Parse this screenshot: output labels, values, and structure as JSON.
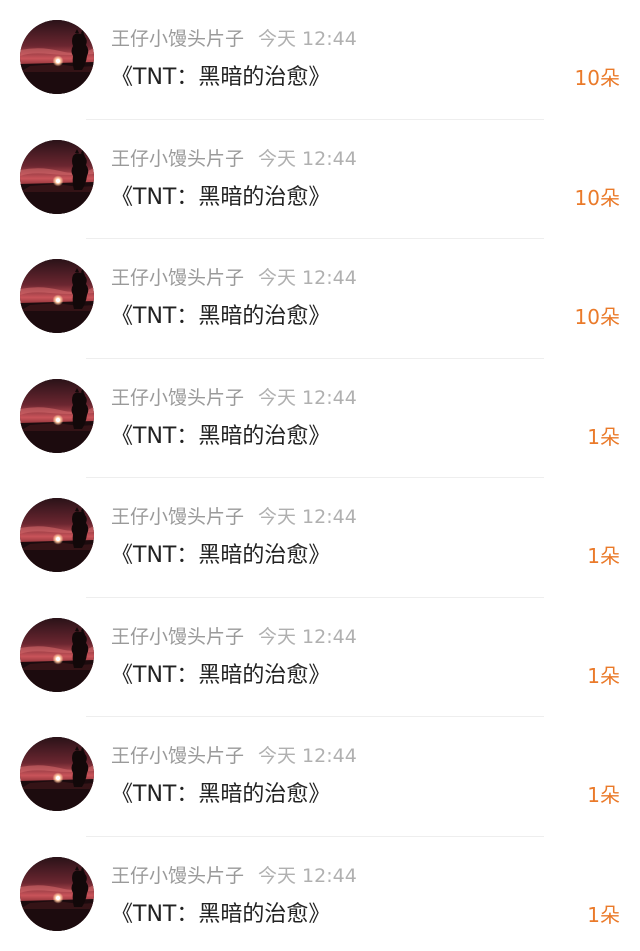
{
  "colors": {
    "name": "#9a9a9a",
    "time": "#b0b0b0",
    "title": "#222222",
    "count": "#ea7a2a",
    "divider": "#eeeeee"
  },
  "gift_list": [
    {
      "sender": "王仔小馒头片子",
      "time": "今天 12:44",
      "gift": "《TNT：黑暗的治愈》",
      "count": "10朵",
      "avatar": "sunset-avatar-icon"
    },
    {
      "sender": "王仔小馒头片子",
      "time": "今天 12:44",
      "gift": "《TNT：黑暗的治愈》",
      "count": "10朵",
      "avatar": "sunset-avatar-icon"
    },
    {
      "sender": "王仔小馒头片子",
      "time": "今天 12:44",
      "gift": "《TNT：黑暗的治愈》",
      "count": "10朵",
      "avatar": "sunset-avatar-icon"
    },
    {
      "sender": "王仔小馒头片子",
      "time": "今天 12:44",
      "gift": "《TNT：黑暗的治愈》",
      "count": "1朵",
      "avatar": "sunset-avatar-icon"
    },
    {
      "sender": "王仔小馒头片子",
      "time": "今天 12:44",
      "gift": "《TNT：黑暗的治愈》",
      "count": "1朵",
      "avatar": "sunset-avatar-icon"
    },
    {
      "sender": "王仔小馒头片子",
      "time": "今天 12:44",
      "gift": "《TNT：黑暗的治愈》",
      "count": "1朵",
      "avatar": "sunset-avatar-icon"
    },
    {
      "sender": "王仔小馒头片子",
      "time": "今天 12:44",
      "gift": "《TNT：黑暗的治愈》",
      "count": "1朵",
      "avatar": "sunset-avatar-icon"
    },
    {
      "sender": "王仔小馒头片子",
      "time": "今天 12:44",
      "gift": "《TNT：黑暗的治愈》",
      "count": "1朵",
      "avatar": "sunset-avatar-icon"
    }
  ]
}
